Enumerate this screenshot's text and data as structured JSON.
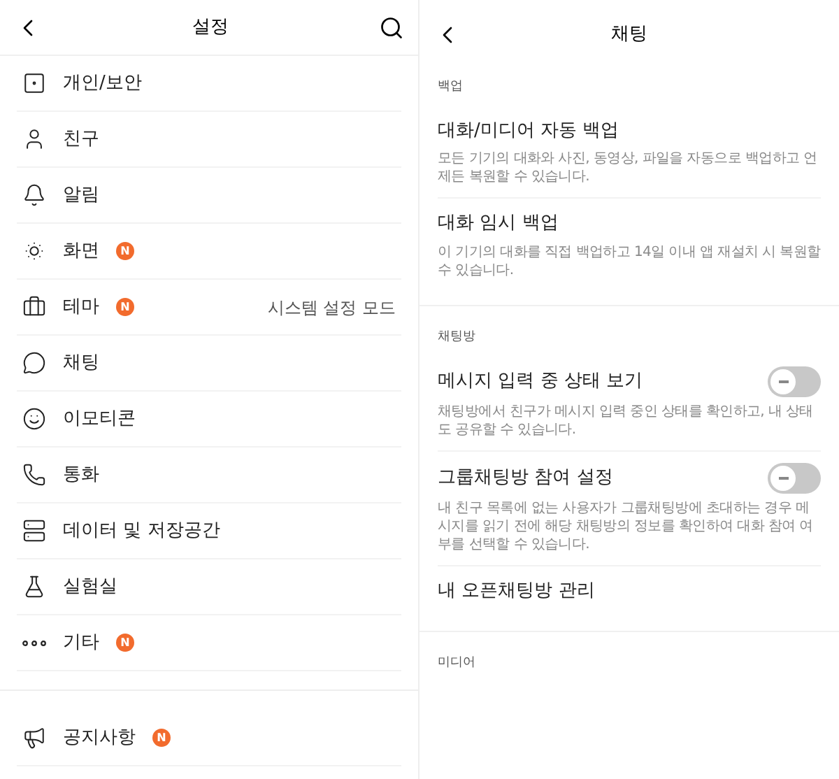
{
  "settings_screen": {
    "title": "설정",
    "items": [
      {
        "label": "개인/보안"
      },
      {
        "label": "친구"
      },
      {
        "label": "알림"
      },
      {
        "label": "화면",
        "badge": "N"
      },
      {
        "label": "테마",
        "badge": "N",
        "value": "시스템 설정 모드"
      },
      {
        "label": "채팅"
      },
      {
        "label": "이모티콘"
      },
      {
        "label": "통화"
      },
      {
        "label": "데이터 및 저장공간"
      },
      {
        "label": "실험실"
      },
      {
        "label": "기타",
        "badge": "N"
      }
    ],
    "support_items": [
      {
        "label": "공지사항",
        "badge": "N"
      }
    ]
  },
  "chat_screen": {
    "title": "채팅",
    "sections": [
      {
        "heading": "백업",
        "items": [
          {
            "kind": "link",
            "label": "대화/미디어 자동 백업",
            "description": "모든 기기의 대화와 사진, 동영상, 파일을 자동으로 백업하고 언제든 복원할 수 있습니다."
          },
          {
            "kind": "link",
            "label": "대화 임시 백업",
            "description": "이 기기의 대화를 직접 백업하고 14일 이내 앱 재설치 시 복원할 수 있습니다."
          }
        ]
      },
      {
        "heading": "채팅방",
        "items": [
          {
            "kind": "toggle",
            "label": "메시지 입력 중 상태 보기",
            "on": false,
            "description": "채팅방에서 친구가 메시지 입력 중인 상태를 확인하고, 내 상태도 공유할 수 있습니다."
          },
          {
            "kind": "toggle",
            "label": "그룹채팅방 참여 설정",
            "on": false,
            "description": "내 친구 목록에 없는 사용자가 그룹채팅방에 초대하는 경우 메시지를 읽기 전에 해당 채팅방의 정보를 확인하여 대화 참여 여부를 선택할 수 있습니다."
          },
          {
            "kind": "link",
            "label": "내 오픈채팅방 관리"
          }
        ]
      },
      {
        "heading": "미디어"
      }
    ]
  }
}
